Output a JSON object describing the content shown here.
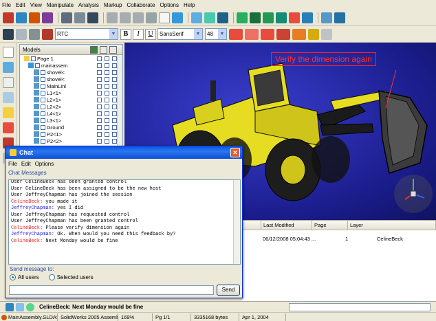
{
  "menu": [
    "File",
    "Edit",
    "View",
    "Manipulate",
    "Analysis",
    "Markup",
    "Collaborate",
    "Options",
    "Help"
  ],
  "format_bar": {
    "font1": "RTC",
    "bold": "B",
    "italic": "I",
    "underline": "U",
    "font2": "SansSerif",
    "size": "48"
  },
  "models_panel": {
    "title": "Models",
    "tree": [
      "Page 1",
      "mainassem",
      "shovel<",
      "shovel<",
      "MainLinl",
      "L1<1>",
      "L2<1>",
      "L2<2>",
      "L4<1>",
      "L3<1>",
      "Ground",
      "P2<1>",
      "P2<2>"
    ]
  },
  "viewport": {
    "annotation": "Verify the dimension again",
    "colors": {
      "background": "#2527a8",
      "loader": "#e8e22a",
      "annotation": "#ff3030"
    }
  },
  "properties": {
    "columns": [
      "Last Modified",
      "Page",
      "Layer"
    ],
    "rows": [
      {
        "modified": "06/12/2008 05:04:43 ...",
        "page": "1",
        "layer": "CelineBeck"
      }
    ]
  },
  "chat": {
    "title": "Chat",
    "menu": [
      "File",
      "Edit",
      "Options"
    ],
    "messages_label": "Chat Messages",
    "messages": [
      {
        "user": "",
        "text": "User CelineBeck has been granted control",
        "color": "#000000"
      },
      {
        "user": "",
        "text": "User CelineBeck has been assigned to be the new host",
        "color": "#000000"
      },
      {
        "user": "",
        "text": "User JeffreyChapman has joined the session",
        "color": "#000000"
      },
      {
        "user": "CelineBeck:",
        "text": "you made it",
        "color": "#e02020"
      },
      {
        "user": "JeffreyChapman:",
        "text": "yes I did",
        "color": "#2020e0"
      },
      {
        "user": "",
        "text": "User JeffreyChapman has requested control",
        "color": "#000000"
      },
      {
        "user": "",
        "text": "User JeffreyChapman has been granted control",
        "color": "#000000"
      },
      {
        "user": "CelineBeck:",
        "text": "Please verify dimension again",
        "color": "#e02020"
      },
      {
        "user": "JeffreyChapman:",
        "text": "Ok.  When would you need this feedback by?",
        "color": "#2020e0"
      },
      {
        "user": "CelineBeck:",
        "text": "Next Monday would be fine",
        "color": "#e02020"
      }
    ],
    "send_label": "Send message to:",
    "radio_all": "All users",
    "radio_selected": "Selected users",
    "send_button": "Send"
  },
  "bottom_bar": {
    "last_message": "CelineBeck: Next Monday would be fine"
  },
  "status_bar": [
    "MainAssembly.SLDASM",
    "SolidWorks 2005 Assembly",
    "169%",
    "Pg 1/1",
    "3335168 bytes",
    "Apr 1, 2004"
  ]
}
